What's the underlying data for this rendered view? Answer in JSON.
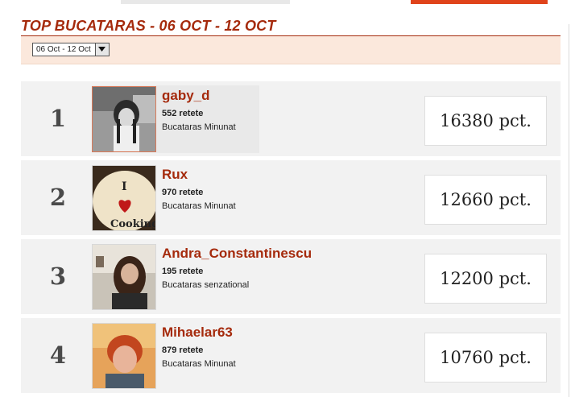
{
  "header": {
    "title": "TOP BUCATARAS - 06 OCT - 12 OCT"
  },
  "filter": {
    "selected": "06 Oct - 12 Oct"
  },
  "colors": {
    "accent": "#a52a0c",
    "filter_bg": "#fbe8dc",
    "row_bg": "#f2f2f2"
  },
  "entries": [
    {
      "rank": "1",
      "username": "gaby_d",
      "recipes": "552 retete",
      "title": "Bucataras Minunat",
      "points": "16380 pct.",
      "avatar_icon": "user-photo"
    },
    {
      "rank": "2",
      "username": "Rux",
      "recipes": "970 retete",
      "title": "Bucataras Minunat",
      "points": "12660 pct.",
      "avatar_icon": "i-love-cooking-image",
      "avatar_text_1": "I",
      "avatar_text_2": "Cooking"
    },
    {
      "rank": "3",
      "username": "Andra_Constantinescu",
      "recipes": "195 retete",
      "title": "Bucataras senzational",
      "points": "12200 pct.",
      "avatar_icon": "user-photo"
    },
    {
      "rank": "4",
      "username": "Mihaelar63",
      "recipes": "879 retete",
      "title": "Bucataras Minunat",
      "points": "10760 pct.",
      "avatar_icon": "user-photo"
    }
  ]
}
